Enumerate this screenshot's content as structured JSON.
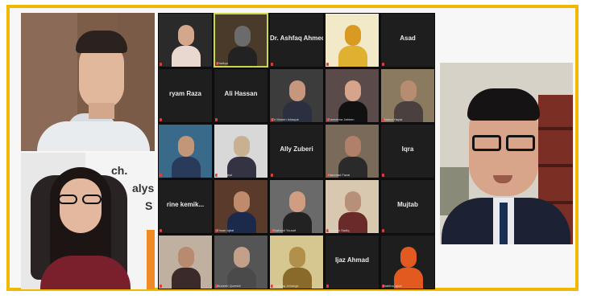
{
  "meeting": {
    "tiles": [
      {
        "label": "",
        "caption": ""
      },
      {
        "label": "",
        "caption": "Hadiqa"
      },
      {
        "label": "Dr. Ashfaq Ahmed",
        "caption": ""
      },
      {
        "label": "",
        "caption": ""
      },
      {
        "label": "Asad",
        "caption": ""
      },
      {
        "label": "ryam Raza",
        "caption": ""
      },
      {
        "label": "Ali Hassan",
        "caption": ""
      },
      {
        "label": "",
        "caption": "Dr Moeen Ishaque"
      },
      {
        "label": "",
        "caption": "Zarmeena Jabeen"
      },
      {
        "label": "",
        "caption": "Samra Hayat"
      },
      {
        "label": "",
        "caption": ""
      },
      {
        "label": "",
        "caption": "Arshi Iqbal"
      },
      {
        "label": "Ally Zuberi",
        "caption": ""
      },
      {
        "label": "",
        "caption": "Hammad Fazal"
      },
      {
        "label": "Iqra",
        "caption": ""
      },
      {
        "label": "rine  kemik...",
        "caption": ""
      },
      {
        "label": "",
        "caption": "Ehsan Iqbal"
      },
      {
        "label": "",
        "caption": "Shahzad Yousaf"
      },
      {
        "label": "",
        "caption": "Nasreen Sadiq"
      },
      {
        "label": "Mujtab",
        "caption": ""
      },
      {
        "label": "",
        "caption": ""
      },
      {
        "label": "",
        "caption": "Muneeb Qureshi"
      },
      {
        "label": "",
        "caption": "Dr Ishfaq Jehangir"
      },
      {
        "label": "Ijaz Ahmad",
        "caption": ""
      },
      {
        "label": "",
        "caption": "Nabiha Iqbal"
      }
    ]
  },
  "slide": {
    "line1": "ch.",
    "line2": "alysis",
    "line3": "S"
  },
  "colors": {
    "frame": "#f0b800",
    "active_speaker": "#c9d84a"
  }
}
